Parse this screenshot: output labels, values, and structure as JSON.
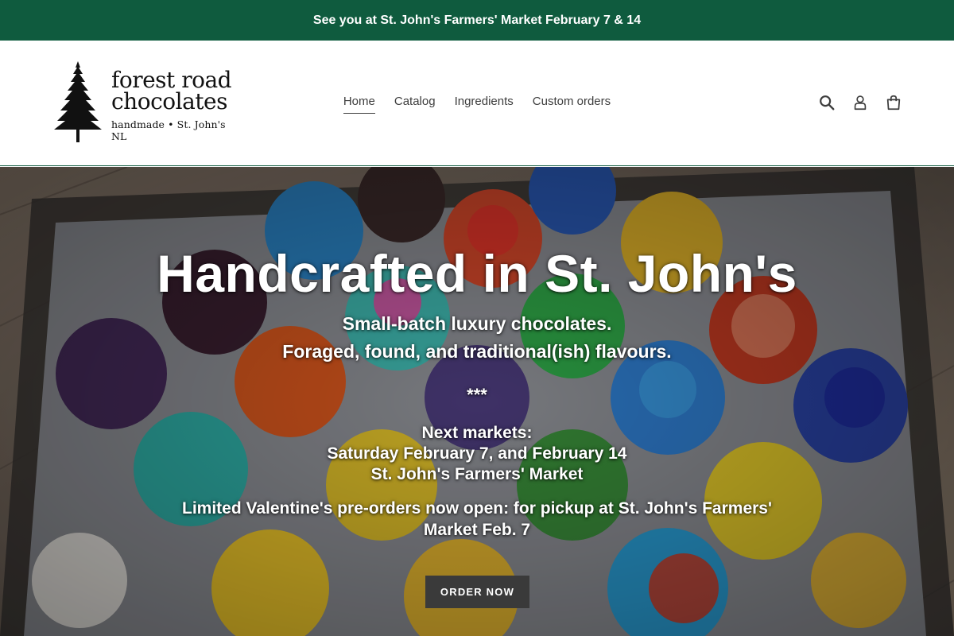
{
  "announcement": {
    "text": "See you at St. John's Farmers' Market February 7 & 14"
  },
  "logo": {
    "line1": "forest road",
    "line2": "chocolates",
    "tagline": "handmade • St. John's NL"
  },
  "nav": {
    "items": [
      {
        "label": "Home",
        "active": true
      },
      {
        "label": "Catalog"
      },
      {
        "label": "Ingredients"
      },
      {
        "label": "Custom orders"
      }
    ]
  },
  "icons": {
    "search": "search-icon",
    "account": "account-icon",
    "cart": "cart-icon"
  },
  "hero": {
    "title": "Handcrafted in St. John's",
    "subtitle1": "Small-batch luxury chocolates.",
    "subtitle2": "Foraged, found, and traditional(ish) flavours.",
    "separator": "***",
    "markets_heading": "Next markets:",
    "markets_dates": "Saturday February 7, and February 14",
    "markets_location": "St. John's Farmers' Market",
    "preorder": "Limited Valentine's pre-orders now open: for pickup at St. John's Farmers' Market Feb. 7",
    "button_label": "ORDER NOW"
  },
  "colors": {
    "brand_green": "#0f5b3e",
    "button_dark": "#3a3a3a",
    "text_dark": "#3d3d3d"
  }
}
